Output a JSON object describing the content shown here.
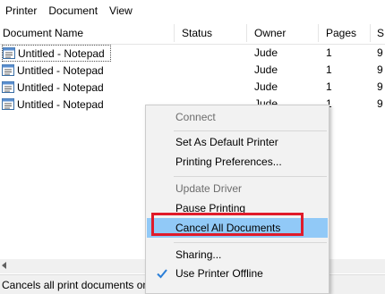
{
  "menubar": {
    "items": [
      "Printer",
      "Document",
      "View"
    ]
  },
  "columns": [
    "Document Name",
    "Status",
    "Owner",
    "Pages",
    "S"
  ],
  "rows": [
    {
      "name": "Untitled - Notepad",
      "status": "",
      "owner": "Jude",
      "pages": "1",
      "size": "9"
    },
    {
      "name": "Untitled - Notepad",
      "status": "",
      "owner": "Jude",
      "pages": "1",
      "size": "9"
    },
    {
      "name": "Untitled - Notepad",
      "status": "",
      "owner": "Jude",
      "pages": "1",
      "size": "9"
    },
    {
      "name": "Untitled - Notepad",
      "status": "",
      "owner": "Jude",
      "pages": "1",
      "size": "9"
    }
  ],
  "status_bar": {
    "text": "Cancels all print documents on"
  },
  "context_menu": {
    "connect": "Connect",
    "set_default": "Set As Default Printer",
    "preferences": "Printing Preferences...",
    "update_driver": "Update Driver",
    "pause": "Pause Printing",
    "cancel_all": "Cancel All Documents",
    "sharing": "Sharing...",
    "offline": "Use Printer Offline"
  },
  "colors": {
    "highlight_box": "#e01b2a",
    "menu_hover": "#91c9f7",
    "check": "#2b7fd8"
  },
  "icons": {
    "document": "document-icon",
    "checkmark": "checkmark-icon",
    "scroll_left": "scroll-left-arrow-icon"
  }
}
